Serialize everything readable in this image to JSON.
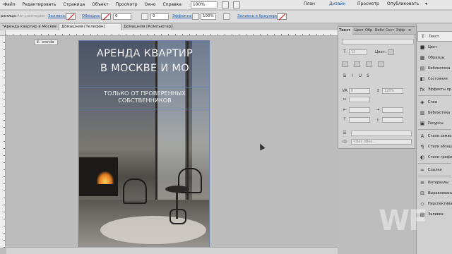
{
  "menu": [
    "Файл",
    "Редактировать",
    "Страница",
    "Объект",
    "Просмотр",
    "Окно",
    "Справка"
  ],
  "zoom": "100%",
  "workspaces": {
    "plan": "План",
    "design": "Дизайн",
    "preview": "Просмотр",
    "publish": "Опубликовать"
  },
  "control_bar": {
    "page_label": "раница:",
    "page_value": "Авт.размеров",
    "fill_label": "Заливка:",
    "stroke_label": "Обводка:",
    "stroke_value": "0",
    "corner_value": "0",
    "effects_label": "Эффекты:",
    "opacity_value": "100%",
    "browser_fill_label": "Заливка в браузере:"
  },
  "doc_tabs": [
    "*Аренда квартир в Москве",
    "Домашняя [Телефон]",
    "Домашняя [Компьютер]"
  ],
  "page_label": "arenda",
  "hero": {
    "title_line1": "АРЕНДА КВАРТИР",
    "title_line2": "В МОСКВЕ И МО",
    "subtitle_line1": "ТОЛЬКО ОТ ПРОВЕРЕННЫХ",
    "subtitle_line2": "СОБСТВЕННИКОВ"
  },
  "text_panel": {
    "tabs": [
      "Текст",
      "Цвет",
      "Обр",
      "Библ",
      "Сост",
      "Эфф"
    ],
    "size_value": "12",
    "color_label": "Цвет:",
    "kerning_value": "0",
    "scale_value": "120%",
    "style_value": "<Без обно..."
  },
  "dock": [
    {
      "icon": "text-icon",
      "glyph": "T",
      "label": "Текст"
    },
    {
      "icon": "color-icon",
      "glyph": "■",
      "label": "Цвет"
    },
    {
      "icon": "swatches-icon",
      "glyph": "▦",
      "label": "Образцы"
    },
    {
      "icon": "library-icon",
      "glyph": "▤",
      "label": "Библиотека"
    },
    {
      "icon": "states-icon",
      "glyph": "◧",
      "label": "Состояния"
    },
    {
      "icon": "effects-icon",
      "glyph": "fx",
      "label": "Эффекты пр"
    },
    {
      "icon": "layers-icon",
      "glyph": "◈",
      "label": "Слои"
    },
    {
      "icon": "library2-icon",
      "glyph": "▥",
      "label": "Библиотека"
    },
    {
      "icon": "assets-icon",
      "glyph": "▣",
      "label": "Ресурсы"
    },
    {
      "icon": "char-styles-icon",
      "glyph": "A",
      "label": "Стили симво"
    },
    {
      "icon": "para-styles-icon",
      "glyph": "¶",
      "label": "Стили абзаца"
    },
    {
      "icon": "graphic-styles-icon",
      "glyph": "◐",
      "label": "Стили графи"
    },
    {
      "icon": "hyperlinks-icon",
      "glyph": "∞",
      "label": "Ссылки"
    },
    {
      "icon": "spacing-icon",
      "glyph": "≡",
      "label": "Интервалы"
    },
    {
      "icon": "align-icon",
      "glyph": "⊟",
      "label": "Выравнивание"
    },
    {
      "icon": "perspective-icon",
      "glyph": "◇",
      "label": "Перспектива"
    },
    {
      "icon": "wrap-icon",
      "glyph": "▧",
      "label": "Заливка"
    }
  ],
  "watermark": "WF"
}
